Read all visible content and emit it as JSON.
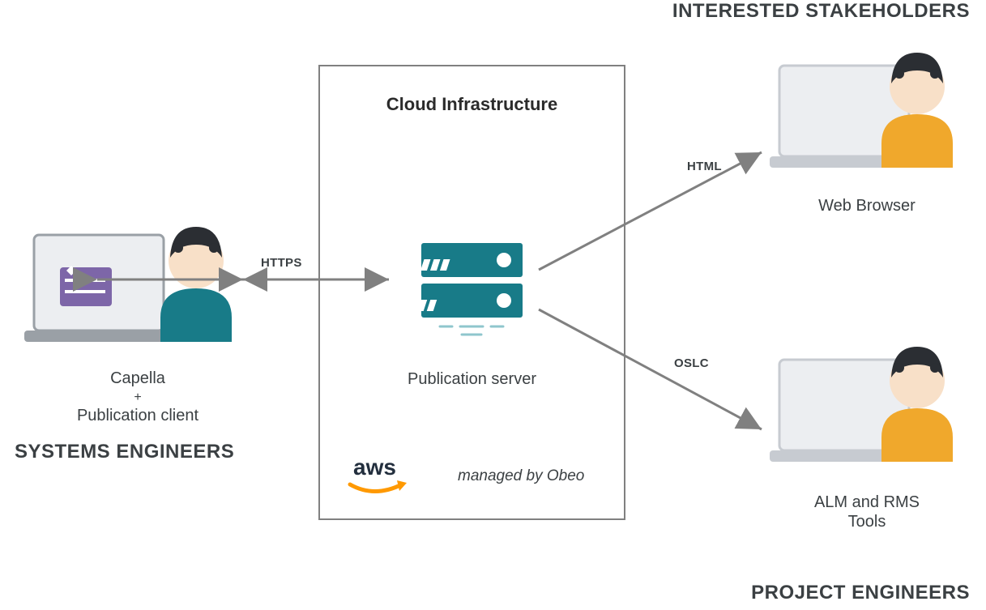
{
  "roles": {
    "stakeholders": "INTERESTED STAKEHOLDERS",
    "systems_engineers": "SYSTEMS ENGINEERS",
    "project_engineers": "PROJECT ENGINEERS"
  },
  "cloud": {
    "title": "Cloud Infrastructure",
    "server_label": "Publication server",
    "managed_by": "managed by Obeo",
    "provider": "aws"
  },
  "left": {
    "line1": "Capella",
    "plus": "+",
    "line2": "Publication client"
  },
  "right_top": {
    "label": "Web Browser"
  },
  "right_bottom": {
    "line1": "ALM and RMS",
    "line2": "Tools"
  },
  "arrows": {
    "https": "HTTPS",
    "html": "HTML",
    "oslc": "OSLC"
  }
}
